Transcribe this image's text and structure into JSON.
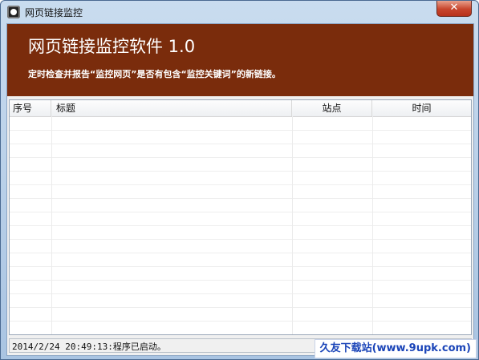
{
  "window": {
    "title": "网页链接监控",
    "close_label": "✕"
  },
  "banner": {
    "title": "网页链接监控软件 1.0",
    "subtitle": "定时检查并报告“监控网页”是否有包含“监控关键词”的新链接。"
  },
  "table": {
    "columns": [
      "序号",
      "标题",
      "站点",
      "时间"
    ],
    "rows": []
  },
  "status": {
    "text": "2014/2/24 20:49:13:程序已启动。"
  },
  "watermark": {
    "text": "久友下载站(www.9upk.com)"
  },
  "colors": {
    "banner_bg": "#7a2c0c",
    "banner_text": "#ffffff"
  }
}
